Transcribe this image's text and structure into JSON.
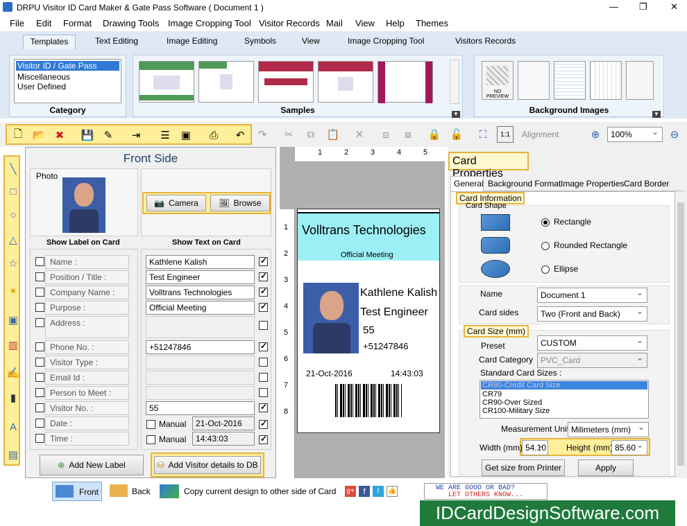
{
  "window": {
    "title": "DRPU Visitor ID Card Maker & Gate Pass Software ( Document 1 )",
    "minimize": "—",
    "restore": "❐",
    "close": "✕"
  },
  "menu": [
    "File",
    "Edit",
    "Format",
    "Drawing Tools",
    "Image Cropping Tool",
    "Visitor Records",
    "Mail",
    "View",
    "Help",
    "Themes"
  ],
  "ribbon_tabs": [
    "Templates",
    "Text Editing",
    "Image Editing",
    "Symbols",
    "View",
    "Image Cropping Tool",
    "Visitors Records"
  ],
  "category": {
    "label": "Category",
    "items": [
      "Visitor ID / Gate Pass",
      "Miscellaneous",
      "User Defined"
    ],
    "selected": 0
  },
  "samples": {
    "label": "Samples"
  },
  "background_images": {
    "label": "Background Images",
    "no_preview": "NO PREVIEW"
  },
  "toolbar": {
    "alignment": "Alignment",
    "zoom": "100%"
  },
  "front": {
    "title": "Front Side",
    "photo_label": "Photo",
    "camera": "Camera",
    "browse": "Browse",
    "show_label": "Show Label on Card",
    "show_text": "Show Text on Card",
    "fields": [
      {
        "label": "Name :",
        "value": "Kathlene Kalish",
        "show": true,
        "lchk": false
      },
      {
        "label": "Position / Title :",
        "value": "Test Engineer",
        "show": true,
        "lchk": false
      },
      {
        "label": "Company Name :",
        "value": "Volltrans Technologies",
        "show": true,
        "lchk": false
      },
      {
        "label": "Purpose :",
        "value": "Official Meeting",
        "show": true,
        "lchk": false
      },
      {
        "label": "Address :",
        "value": "",
        "show": false,
        "lchk": false
      },
      {
        "label": "Phone No. :",
        "value": "+51247846",
        "show": true,
        "lchk": false
      },
      {
        "label": "Visitor Type :",
        "value": "",
        "show": false,
        "lchk": false
      },
      {
        "label": "Email Id :",
        "value": "",
        "show": false,
        "lchk": false
      },
      {
        "label": "Person to Meet :",
        "value": "",
        "show": false,
        "lchk": false
      },
      {
        "label": "Visitor No. :",
        "value": "55",
        "show": true,
        "lchk": false
      },
      {
        "label": "Date :",
        "value": "21-Oct-2016",
        "show": true,
        "lchk": false,
        "manual": "Manual"
      },
      {
        "label": "Time :",
        "value": "14:43:03",
        "show": true,
        "lchk": false,
        "manual": "Manual"
      }
    ],
    "add_label": "Add New Label",
    "add_db": "Add Visitor details to DB"
  },
  "ruler": {
    "h": [
      "1",
      "2",
      "3",
      "4",
      "5"
    ],
    "v": [
      "1",
      "2",
      "3",
      "4",
      "5",
      "6",
      "7",
      "8"
    ]
  },
  "card": {
    "company": "Volltrans Technologies",
    "purpose": "Official Meeting",
    "name": "Kathlene Kalish",
    "title": "Test Engineer",
    "number": "55",
    "phone": "+51247846",
    "date": "21-Oct-2016",
    "time": "14:43:03",
    "header_color": "#9cf0f5"
  },
  "props": {
    "title": "Card Properties",
    "tabs": [
      "General",
      "Background Format",
      "Image Properties",
      "Card Border"
    ],
    "card_information": "Card Information",
    "card_shape": "Card Shape",
    "shapes": [
      "Rectangle",
      "Rounded Rectangle",
      "Ellipse"
    ],
    "name_label": "Name",
    "name_value": "Document 1",
    "sides_label": "Card sides",
    "sides_value": "Two (Front and Back)",
    "card_size": "Card Size (mm)",
    "preset_label": "Preset",
    "preset_value": "CUSTOM",
    "category_label": "Card Category",
    "category_value": "PVC_Card",
    "std_sizes_label": "Standard Card Sizes :",
    "std_sizes": [
      "CR80-Credit Card Size",
      "CR79",
      "CR90-Over Sized",
      "CR100-Military Size"
    ],
    "unit_label": "Measurement Unit :",
    "unit_value": "Milimeters (mm)",
    "width_label": "Width  (mm)",
    "width_value": "54.10",
    "height_label": "Height",
    "height_unit": "(mm)",
    "height_value": "85.60",
    "get_size": "Get size from Printer",
    "apply": "Apply"
  },
  "status": {
    "front": "Front",
    "back": "Back",
    "copy": "Copy current design to other side of Card",
    "feedback1": "WE ARE GOOD OR BAD?",
    "feedback2": "LET OTHERS KNOW..."
  },
  "brand": "IDCardDesignSoftware.com"
}
